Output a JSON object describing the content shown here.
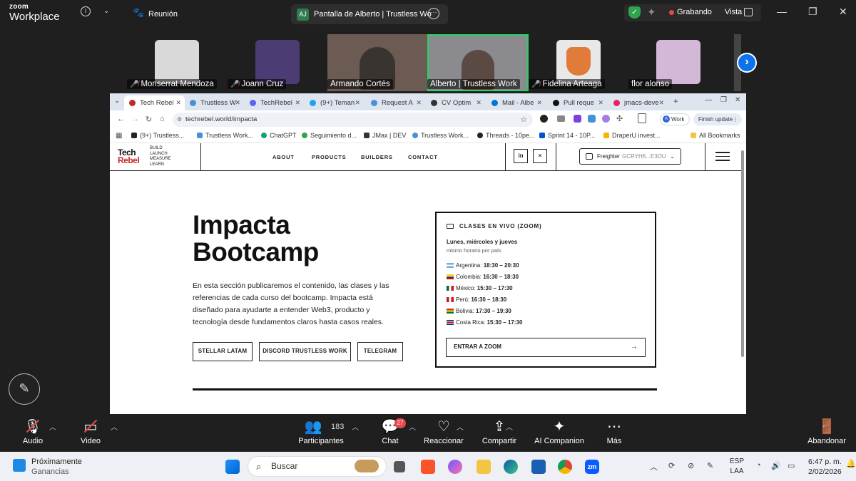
{
  "zoom": {
    "brand_line1": "zoom",
    "brand_line2": "Workplace",
    "meeting_tab": "Reunión",
    "share_badge": "AJ",
    "share_title": "Pantalla de Alberto | Trustless Wo",
    "recording": "Grabando",
    "view": "Vista",
    "participants": [
      {
        "name": "Monserrat Mendoza",
        "muted": true,
        "video": false
      },
      {
        "name": "Joann Cruz",
        "muted": true,
        "video": false
      },
      {
        "name": "Armando Cortés",
        "muted": false,
        "video": true
      },
      {
        "name": "Alberto | Trustless Work",
        "muted": false,
        "video": true,
        "active": true
      },
      {
        "name": "Fidelina Arteaga",
        "muted": true,
        "video": false
      },
      {
        "name": "flor alonso",
        "muted": false,
        "video": false
      }
    ],
    "toolbar": {
      "audio": "Audio",
      "video": "Video",
      "participants": "Participantes",
      "participants_count": "183",
      "chat": "Chat",
      "chat_badge": "27",
      "react": "Reaccionar",
      "share": "Compartir",
      "ai": "AI Companion",
      "more": "Más",
      "leave": "Abandonar"
    },
    "colors": {
      "accent": "#0e72ed",
      "recording": "#e5484d",
      "active_speaker": "#24d366"
    }
  },
  "browser": {
    "tabs": [
      {
        "label": "Tech Rebel",
        "active": true,
        "color": "#c62828"
      },
      {
        "label": "Trustless W",
        "color": "#4a90d9"
      },
      {
        "label": "TechRebel",
        "color": "#5865f2"
      },
      {
        "label": "(9+) Teman",
        "color": "#1da1f2"
      },
      {
        "label": "Request A",
        "color": "#4a90d9"
      },
      {
        "label": "CV Optim",
        "color": "#333333"
      },
      {
        "label": "Mail - Albe",
        "color": "#0078d4"
      },
      {
        "label": "Pull reque",
        "color": "#111111"
      },
      {
        "label": "jmacs-deve",
        "color": "#e91e63"
      }
    ],
    "url": "techrebel.world/impacta",
    "profile": "Work",
    "profile_initial": "A",
    "finish_update": "Finish update",
    "bookmarks": [
      "(9+) Trustless...",
      "Trustless Work...",
      "ChatGPT",
      "Seguimiento d...",
      "JMax | DEV",
      "Trustless Work...",
      "Threads - 10pe...",
      "Sprint 14 - 10P...",
      "DraperU invest..."
    ],
    "all_bookmarks": "All Bookmarks"
  },
  "site": {
    "logo_top": "Tech",
    "logo_bottom": "Rebel",
    "tagline": [
      "BUILD",
      "LAUNCH",
      "MEASURE",
      "LEARN"
    ],
    "nav": [
      "ABOUT",
      "PRODUCTS",
      "BUILDERS",
      "CONTACT"
    ],
    "social": [
      "in",
      "×"
    ],
    "wallet": "Freighter",
    "wallet_addr": "GCRYH6...E3OU",
    "title_line1": "Impacta",
    "title_line2": "Bootcamp",
    "description": "En esta sección publicaremos el contenido, las clases y las referencias de cada curso del bootcamp. Impacta está diseñado para ayudarte a entender Web3, producto y tecnología desde fundamentos claros hasta casos reales.",
    "buttons": [
      "STELLAR LATAM",
      "DISCORD TRUSTLESS WORK",
      "TELEGRAM"
    ],
    "card": {
      "heading": "CLASES EN VIVO (ZOOM)",
      "days": "Lunes, miércoles y jueves",
      "note": "mismo horario por país",
      "schedule": [
        {
          "country": "Argentina:",
          "time": "18:30 – 20:30",
          "flag": "ar"
        },
        {
          "country": "Colombia:",
          "time": "16:30 – 18:30",
          "flag": "co"
        },
        {
          "country": "México:",
          "time": "15:30 – 17:30",
          "flag": "mx"
        },
        {
          "country": "Perú:",
          "time": "16:30 – 18:30",
          "flag": "pe"
        },
        {
          "country": "Bolivia:",
          "time": "17:30 – 19:30",
          "flag": "bo"
        },
        {
          "country": "Costa Rica:",
          "time": "15:30 – 17:30",
          "flag": "cr"
        }
      ],
      "cta": "ENTRAR A ZOOM"
    }
  },
  "taskbar": {
    "weather_line1": "Próximamente",
    "weather_line2": "Ganancias",
    "search": "Buscar",
    "lang_line1": "ESP",
    "lang_line2": "LAA",
    "time": "6:47 p. m.",
    "date": "2/02/2026"
  }
}
